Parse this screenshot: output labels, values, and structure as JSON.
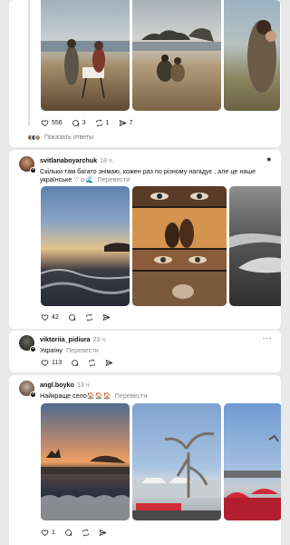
{
  "post1": {
    "stats": {
      "likes": "556",
      "comments": "3",
      "reposts": "1",
      "shares": "7"
    },
    "show_replies": "Показать ответы"
  },
  "post2": {
    "username": "svitlanaboyarchuk",
    "time": "18 ч.",
    "text": "Скільки там багато знімаю, кожен раз по різному нагадує , але це наше українське",
    "emoji": "♡☺🌊",
    "translate": "Перевести",
    "stats": {
      "likes": "42"
    }
  },
  "post3": {
    "username": "viktoriia_pidiura",
    "time": "23 ч.",
    "text": "Україну",
    "translate": "Перевести",
    "stats": {
      "likes": "113"
    }
  },
  "post4": {
    "username": "angl.boyko",
    "time": "13 ч.",
    "text": "Найкраще село",
    "emoji": "🏠🏠🏠",
    "translate": "Перевести",
    "stats": {
      "likes": "1"
    }
  },
  "icons": [
    "heart-icon",
    "comment-icon",
    "repost-icon",
    "share-icon",
    "more-icon"
  ]
}
